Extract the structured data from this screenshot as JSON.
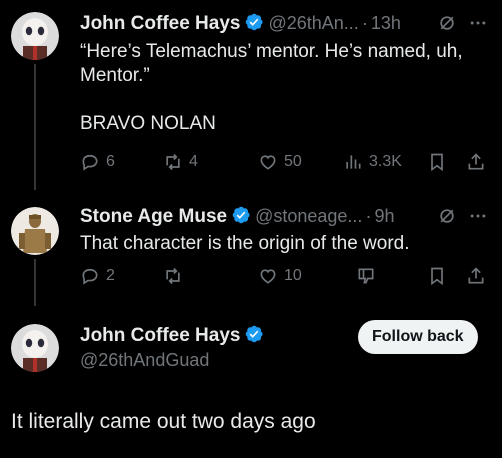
{
  "tweet1": {
    "name": "John Coffee Hays",
    "handle": "@26thAn...",
    "dot": "·",
    "time": "13h",
    "text_line1": "“Here’s Telemachus’ mentor. He’s named, uh,",
    "text_line2": "Mentor.”",
    "text_line3": "BRAVO NOLAN",
    "replies": "6",
    "reposts": "4",
    "likes": "50",
    "views": "3.3K"
  },
  "tweet2": {
    "name": "Stone Age Muse",
    "handle": "@stoneage...",
    "dot": "·",
    "time": "9h",
    "text": "That character is the origin of the word.",
    "replies": "2",
    "likes": "10"
  },
  "tweet3": {
    "name": "John Coffee Hays",
    "handle": "@26thAndGuad",
    "follow_label": "Follow back",
    "text": "It literally came out two days ago"
  },
  "colors": {
    "background": "#000000",
    "text": "#e7e9ea",
    "muted": "#71767b",
    "verified": "#1d9bf0"
  }
}
